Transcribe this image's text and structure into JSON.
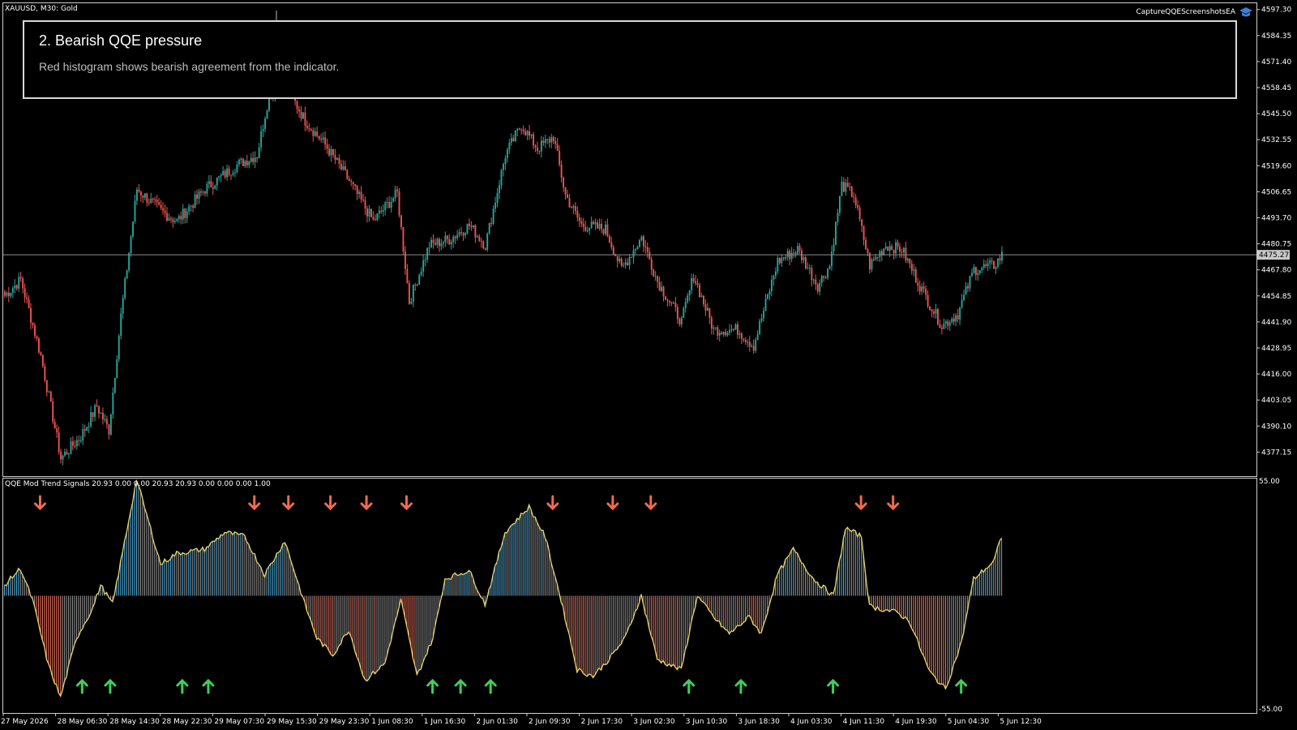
{
  "window": {
    "symbol_title": "XAUUSD, M30:  Gold",
    "ea_name": "CaptureQQEScreenshotsEA",
    "ea_icon": "graduation-cap-icon"
  },
  "annotation": {
    "title": "2. Bearish QQE pressure",
    "text": "Red histogram shows bearish agreement from the indicator."
  },
  "price_axis": {
    "labels": [
      "4597.30",
      "4584.35",
      "4571.40",
      "4558.45",
      "4545.50",
      "4532.55",
      "4519.60",
      "4506.65",
      "4493.70",
      "4480.75",
      "4467.80",
      "4454.85",
      "4441.90",
      "4428.95",
      "4416.00",
      "4403.05",
      "4390.10",
      "4377.15"
    ],
    "current_price": "4475.27",
    "min": 4366.0,
    "max": 4600.0
  },
  "indicator": {
    "title": "QQE Mod Trend Signals 20.93 0.00 0.00 20.93 20.93 0.00 0.00 0.00 1.00",
    "axis_top": "55.00",
    "axis_bottom": "-55.00"
  },
  "time_axis": {
    "labels": [
      "27 May 2026",
      "28 May 06:30",
      "28 May 14:30",
      "28 May 22:30",
      "29 May 07:30",
      "29 May 15:30",
      "29 May 23:30",
      "1 Jun 08:30",
      "1 Jun 16:30",
      "2 Jun 01:30",
      "2 Jun 09:30",
      "2 Jun 17:30",
      "3 Jun 02:30",
      "3 Jun 10:30",
      "3 Jun 18:30",
      "4 Jun 03:30",
      "4 Jun 11:30",
      "4 Jun 19:30",
      "5 Jun 04:30",
      "5 Jun 12:30"
    ]
  },
  "colors": {
    "bull": "#26a69a",
    "bear": "#ef5350",
    "hist_blue": "#4fa9d9",
    "hist_red": "#e0705f",
    "hist_gray": "#8c8c8c",
    "qqe_line": "#e8d56e",
    "arrow_up": "#3ecf5a",
    "arrow_down": "#f26a4e"
  },
  "chart_data": [
    {
      "type": "candlestick",
      "symbol": "XAUUSD",
      "timeframe": "M30",
      "anchors": [
        {
          "bar": 0,
          "price": 4455
        },
        {
          "bar": 8,
          "price": 4463
        },
        {
          "bar": 18,
          "price": 4425
        },
        {
          "bar": 28,
          "price": 4374
        },
        {
          "bar": 38,
          "price": 4385
        },
        {
          "bar": 46,
          "price": 4400
        },
        {
          "bar": 52,
          "price": 4388
        },
        {
          "bar": 58,
          "price": 4445
        },
        {
          "bar": 66,
          "price": 4508
        },
        {
          "bar": 78,
          "price": 4497
        },
        {
          "bar": 86,
          "price": 4492
        },
        {
          "bar": 100,
          "price": 4508
        },
        {
          "bar": 116,
          "price": 4520
        },
        {
          "bar": 126,
          "price": 4525
        },
        {
          "bar": 132,
          "price": 4555
        },
        {
          "bar": 140,
          "price": 4560
        },
        {
          "bar": 150,
          "price": 4542
        },
        {
          "bar": 160,
          "price": 4530
        },
        {
          "bar": 172,
          "price": 4512
        },
        {
          "bar": 184,
          "price": 4492
        },
        {
          "bar": 196,
          "price": 4506
        },
        {
          "bar": 202,
          "price": 4452
        },
        {
          "bar": 212,
          "price": 4480
        },
        {
          "bar": 222,
          "price": 4483
        },
        {
          "bar": 232,
          "price": 4490
        },
        {
          "bar": 240,
          "price": 4480
        },
        {
          "bar": 250,
          "price": 4525
        },
        {
          "bar": 258,
          "price": 4540
        },
        {
          "bar": 266,
          "price": 4528
        },
        {
          "bar": 274,
          "price": 4534
        },
        {
          "bar": 280,
          "price": 4505
        },
        {
          "bar": 288,
          "price": 4490
        },
        {
          "bar": 300,
          "price": 4488
        },
        {
          "bar": 308,
          "price": 4468
        },
        {
          "bar": 318,
          "price": 4484
        },
        {
          "bar": 326,
          "price": 4462
        },
        {
          "bar": 338,
          "price": 4442
        },
        {
          "bar": 344,
          "price": 4465
        },
        {
          "bar": 354,
          "price": 4438
        },
        {
          "bar": 366,
          "price": 4438
        },
        {
          "bar": 374,
          "price": 4430
        },
        {
          "bar": 386,
          "price": 4472
        },
        {
          "bar": 396,
          "price": 4478
        },
        {
          "bar": 406,
          "price": 4460
        },
        {
          "bar": 412,
          "price": 4470
        },
        {
          "bar": 418,
          "price": 4510
        },
        {
          "bar": 424,
          "price": 4505
        },
        {
          "bar": 432,
          "price": 4470
        },
        {
          "bar": 440,
          "price": 4480
        },
        {
          "bar": 448,
          "price": 4478
        },
        {
          "bar": 458,
          "price": 4458
        },
        {
          "bar": 468,
          "price": 4440
        },
        {
          "bar": 476,
          "price": 4446
        },
        {
          "bar": 484,
          "price": 4468
        },
        {
          "bar": 494,
          "price": 4470
        },
        {
          "bar": 498,
          "price": 4475
        }
      ]
    },
    {
      "type": "histogram",
      "name": "QQE Mod Trend Signals",
      "ylim": [
        -55,
        55
      ],
      "anchors": [
        {
          "bar": 0,
          "value": 5
        },
        {
          "bar": 8,
          "value": 13
        },
        {
          "bar": 14,
          "value": -2
        },
        {
          "bar": 22,
          "value": -33
        },
        {
          "bar": 28,
          "value": -48
        },
        {
          "bar": 36,
          "value": -20
        },
        {
          "bar": 44,
          "value": -6
        },
        {
          "bar": 48,
          "value": 5
        },
        {
          "bar": 54,
          "value": -4
        },
        {
          "bar": 66,
          "value": 55
        },
        {
          "bar": 78,
          "value": 15
        },
        {
          "bar": 86,
          "value": 20
        },
        {
          "bar": 100,
          "value": 22
        },
        {
          "bar": 110,
          "value": 30
        },
        {
          "bar": 120,
          "value": 28
        },
        {
          "bar": 130,
          "value": 10
        },
        {
          "bar": 140,
          "value": 26
        },
        {
          "bar": 150,
          "value": -4
        },
        {
          "bar": 156,
          "value": -20
        },
        {
          "bar": 164,
          "value": -28
        },
        {
          "bar": 172,
          "value": -16
        },
        {
          "bar": 180,
          "value": -40
        },
        {
          "bar": 190,
          "value": -32
        },
        {
          "bar": 198,
          "value": -2
        },
        {
          "bar": 206,
          "value": -38
        },
        {
          "bar": 214,
          "value": -20
        },
        {
          "bar": 220,
          "value": 8
        },
        {
          "bar": 232,
          "value": 12
        },
        {
          "bar": 240,
          "value": -4
        },
        {
          "bar": 250,
          "value": 30
        },
        {
          "bar": 262,
          "value": 42
        },
        {
          "bar": 270,
          "value": 28
        },
        {
          "bar": 278,
          "value": -2
        },
        {
          "bar": 286,
          "value": -35
        },
        {
          "bar": 294,
          "value": -38
        },
        {
          "bar": 302,
          "value": -30
        },
        {
          "bar": 310,
          "value": -20
        },
        {
          "bar": 318,
          "value": 0
        },
        {
          "bar": 326,
          "value": -30
        },
        {
          "bar": 338,
          "value": -35
        },
        {
          "bar": 346,
          "value": 0
        },
        {
          "bar": 354,
          "value": -10
        },
        {
          "bar": 362,
          "value": -18
        },
        {
          "bar": 372,
          "value": -10
        },
        {
          "bar": 378,
          "value": -18
        },
        {
          "bar": 386,
          "value": 10
        },
        {
          "bar": 394,
          "value": 22
        },
        {
          "bar": 404,
          "value": 8
        },
        {
          "bar": 414,
          "value": 0
        },
        {
          "bar": 420,
          "value": 32
        },
        {
          "bar": 428,
          "value": 28
        },
        {
          "bar": 432,
          "value": -5
        },
        {
          "bar": 446,
          "value": -8
        },
        {
          "bar": 452,
          "value": -12
        },
        {
          "bar": 462,
          "value": -36
        },
        {
          "bar": 470,
          "value": -44
        },
        {
          "bar": 478,
          "value": -22
        },
        {
          "bar": 484,
          "value": 8
        },
        {
          "bar": 494,
          "value": 16
        },
        {
          "bar": 498,
          "value": 28
        }
      ]
    }
  ]
}
